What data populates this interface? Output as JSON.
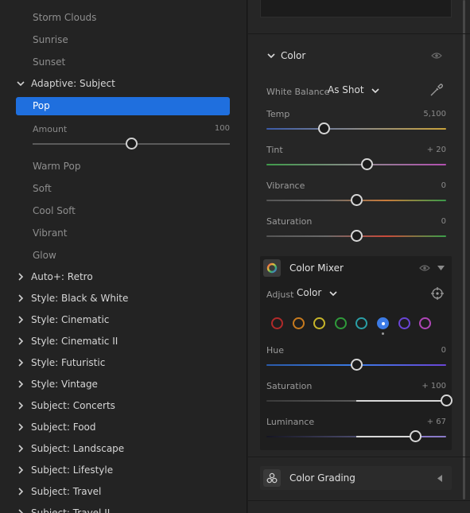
{
  "left_panel": {
    "sub_items_a": [
      "Storm Clouds",
      "Sunrise",
      "Sunset"
    ],
    "adaptive_group": "Adaptive: Subject",
    "selected_preset": "Pop",
    "amount": {
      "label": "Amount",
      "value": "100"
    },
    "sub_items_b": [
      "Warm Pop",
      "Soft",
      "Cool Soft",
      "Vibrant",
      "Glow"
    ],
    "groups": [
      "Auto+: Retro",
      "Style: Black & White",
      "Style: Cinematic",
      "Style: Cinematic II",
      "Style: Futuristic",
      "Style: Vintage",
      "Subject: Concerts",
      "Subject: Food",
      "Subject: Landscape",
      "Subject: Lifestyle",
      "Subject: Travel",
      "Subject: Travel II"
    ]
  },
  "color_panel": {
    "title": "Color",
    "white_balance": {
      "label": "White Balance",
      "value": "As Shot"
    },
    "sliders": [
      {
        "label": "Temp",
        "value": "5,100",
        "fraction": 0.32
      },
      {
        "label": "Tint",
        "value": "+ 20",
        "fraction": 0.56
      },
      {
        "label": "Vibrance",
        "value": "0",
        "fraction": 0.5
      },
      {
        "label": "Saturation",
        "value": "0",
        "fraction": 0.5
      }
    ]
  },
  "color_mixer": {
    "title": "Color Mixer",
    "adjust_label": "Adjust",
    "adjust_value": "Color",
    "swatches": [
      "#b02a2a",
      "#c77a1e",
      "#c7b52a",
      "#2f9a3a",
      "#2a9fa6",
      "#3c7be6",
      "#6a45d6",
      "#b046b8"
    ],
    "selected_swatch_index": 5,
    "sliders": [
      {
        "label": "Hue",
        "value": "0",
        "fraction": 0.5
      },
      {
        "label": "Saturation",
        "value": "+ 100",
        "fraction": 1.0
      },
      {
        "label": "Luminance",
        "value": "+ 67",
        "fraction": 0.83
      }
    ]
  },
  "color_grading": {
    "title": "Color Grading"
  },
  "colors": {
    "accent": "#1f6fde"
  }
}
